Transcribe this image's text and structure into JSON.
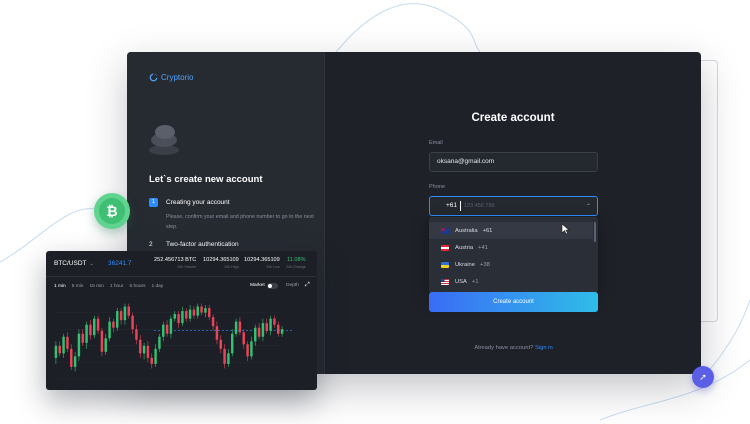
{
  "brand": {
    "name": "Cryptorio",
    "accent": "#2f8cff",
    "bg": "#1e2128"
  },
  "onboarding": {
    "title": "Let`s create new account",
    "steps": [
      {
        "num": "1",
        "title": "Creating your account",
        "desc": "Please, confirm your email and phone number to go to the next step."
      },
      {
        "num": "2",
        "title": "Two-factor authentication"
      }
    ]
  },
  "form": {
    "title": "Create account",
    "email_label": "Email",
    "email_value": "oksana@gmail.com",
    "phone_label": "Phone",
    "phone_code": "+61",
    "phone_placeholder": "123 456 789",
    "submit_label": "Create account",
    "signin_text": "Already have account?",
    "signin_link": "Sign in"
  },
  "country_dropdown": [
    {
      "name": "Australia",
      "code": "+61",
      "flag_icon": "australia-flag-icon",
      "selected": true
    },
    {
      "name": "Austria",
      "code": "+41",
      "flag_icon": "austria-flag-icon",
      "selected": false
    },
    {
      "name": "Ukraine",
      "code": "+38",
      "flag_icon": "ukraine-flag-icon",
      "selected": false
    },
    {
      "name": "USA",
      "code": "+1",
      "flag_icon": "usa-flag-icon",
      "selected": false
    }
  ],
  "chart_widget": {
    "pair": "BTC/USDT",
    "price": "36241.7",
    "stats": [
      {
        "value": "252.456713 BTC",
        "label": "24h Volume"
      },
      {
        "value": "10294.365109",
        "label": "24h High"
      },
      {
        "value": "10294.365109",
        "label": "24h Low"
      },
      {
        "value": "11.08%",
        "label": "24h Change"
      }
    ],
    "timeframes": [
      "1 min",
      "5 min",
      "15 min",
      "1 hour",
      "6 hours",
      "1 day"
    ],
    "market_label": "Market",
    "depth_label": "Depth"
  },
  "chart_data": {
    "type": "candlestick",
    "up_color": "#34c170",
    "down_color": "#e8445a",
    "candles": [
      [
        44,
        52,
        40,
        55
      ],
      [
        52,
        47,
        45,
        55
      ],
      [
        47,
        58,
        44,
        60
      ],
      [
        58,
        50,
        48,
        61
      ],
      [
        50,
        38,
        36,
        53
      ],
      [
        38,
        45,
        35,
        48
      ],
      [
        45,
        60,
        42,
        63
      ],
      [
        60,
        54,
        52,
        63
      ],
      [
        54,
        66,
        50,
        68
      ],
      [
        66,
        59,
        56,
        69
      ],
      [
        59,
        70,
        57,
        72
      ],
      [
        70,
        62,
        60,
        72
      ],
      [
        62,
        48,
        45,
        64
      ],
      [
        48,
        57,
        46,
        60
      ],
      [
        57,
        68,
        55,
        71
      ],
      [
        68,
        64,
        61,
        70
      ],
      [
        64,
        75,
        62,
        77
      ],
      [
        75,
        69,
        66,
        77
      ],
      [
        69,
        78,
        66,
        80
      ],
      [
        78,
        72,
        70,
        80
      ],
      [
        72,
        63,
        60,
        74
      ],
      [
        63,
        56,
        53,
        66
      ],
      [
        56,
        47,
        44,
        59
      ],
      [
        47,
        52,
        43,
        54
      ],
      [
        52,
        44,
        41,
        55
      ],
      [
        44,
        40,
        37,
        47
      ],
      [
        40,
        50,
        38,
        53
      ],
      [
        50,
        58,
        48,
        60
      ],
      [
        58,
        66,
        55,
        68
      ],
      [
        66,
        60,
        58,
        69
      ],
      [
        60,
        70,
        57,
        72
      ],
      [
        70,
        73,
        68,
        75
      ],
      [
        73,
        67,
        64,
        75
      ],
      [
        67,
        75,
        65,
        78
      ],
      [
        75,
        70,
        68,
        77
      ],
      [
        70,
        76,
        68,
        79
      ],
      [
        76,
        72,
        70,
        78
      ],
      [
        72,
        78,
        70,
        80
      ],
      [
        78,
        74,
        72,
        80
      ],
      [
        74,
        77,
        71,
        79
      ],
      [
        77,
        71,
        69,
        79
      ],
      [
        71,
        65,
        62,
        73
      ],
      [
        65,
        56,
        53,
        68
      ],
      [
        56,
        50,
        47,
        59
      ],
      [
        50,
        40,
        37,
        53
      ],
      [
        40,
        47,
        38,
        50
      ],
      [
        47,
        60,
        45,
        63
      ],
      [
        60,
        68,
        58,
        70
      ],
      [
        68,
        61,
        59,
        71
      ],
      [
        61,
        53,
        50,
        63
      ],
      [
        53,
        45,
        42,
        55
      ],
      [
        45,
        55,
        43,
        58
      ],
      [
        55,
        64,
        52,
        66
      ],
      [
        64,
        58,
        56,
        67
      ],
      [
        58,
        67,
        55,
        70
      ],
      [
        67,
        62,
        60,
        70
      ],
      [
        62,
        70,
        59,
        72
      ],
      [
        70,
        66,
        64,
        72
      ],
      [
        66,
        60,
        58,
        68
      ],
      [
        60,
        63,
        58,
        65
      ]
    ],
    "last_price_level": 62
  }
}
